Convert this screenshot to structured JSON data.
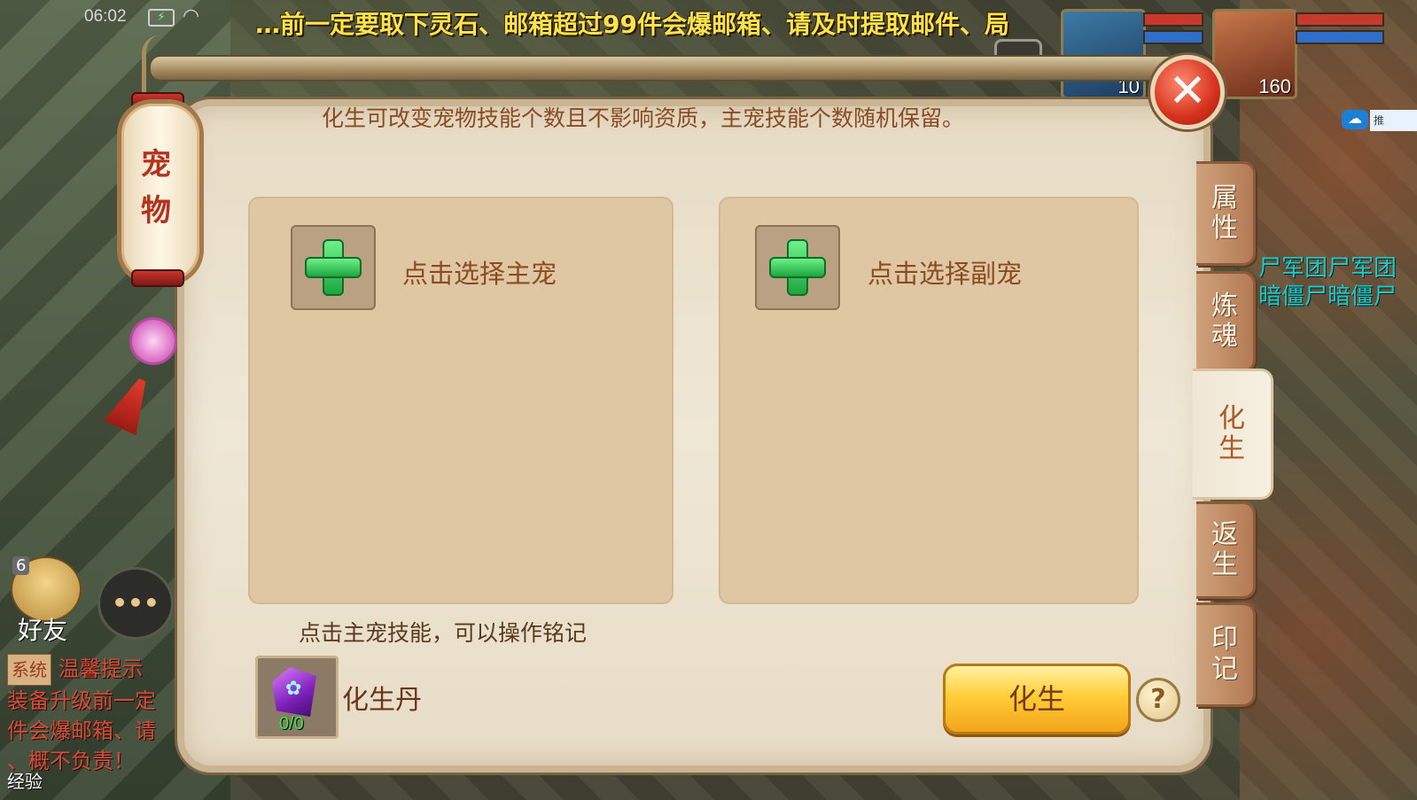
{
  "status_bar": {
    "time": "06:02",
    "battery": "⚡",
    "wifi": "◠"
  },
  "marquee": "…前一定要取下灵石、邮箱超过99件会爆邮箱、请及时提取邮件、局",
  "portraits": [
    {
      "level": "10",
      "colors": {
        "hp": "#c53a2a",
        "mp": "#2f6fc9"
      }
    },
    {
      "level": "160",
      "colors": {
        "hp": "#c53a2a",
        "mp": "#2f6fc9"
      }
    }
  ],
  "lantern": {
    "title_line1": "宠",
    "title_line2": "物"
  },
  "panel": {
    "hint_top": "化生可改变宠物技能个数且不影响资质，主宠技能个数随机保留。",
    "main_slot_label": "点击选择主宠",
    "sub_slot_label": "点击选择副宠",
    "hint_bottom": "点击主宠技能，可以操作铭记",
    "item": {
      "name": "化生丹",
      "count": "0/0",
      "icon": "gem-icon"
    },
    "action_button": "化生",
    "help_button": "?",
    "close_button": "✕"
  },
  "tabs": [
    {
      "line1": "属",
      "line2": "性",
      "active": false
    },
    {
      "line1": "炼",
      "line2": "魂",
      "active": false
    },
    {
      "line1": "化",
      "line2": "生",
      "active": true
    },
    {
      "line1": "返",
      "line2": "生",
      "active": false
    },
    {
      "line1": "印",
      "line2": "记",
      "active": false
    }
  ],
  "hud": {
    "friend_badge": "6",
    "friend_label": "好友",
    "chat_button": "•••",
    "chat_tag": "系统",
    "chat_line1": "温馨提示",
    "chat_line2": "装备升级前一定",
    "chat_line3": "件会爆邮箱、请",
    "chat_line4": "、概不负责！",
    "exp_label": "经验",
    "right_text_1": "尸军团尸军团",
    "right_text_2": "暗僵尸暗僵尸",
    "side_label": "推"
  }
}
